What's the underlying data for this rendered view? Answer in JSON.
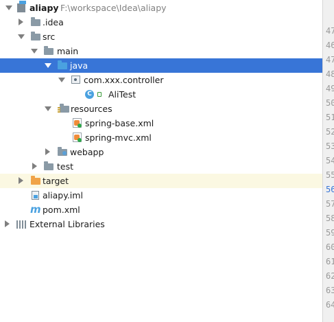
{
  "project_tree": {
    "root": {
      "name": "aliapy",
      "path": "F:\\workspace\\Idea\\aliapy",
      "icon": "module-folder-icon"
    },
    "idea": {
      "name": ".idea",
      "icon": "folder-icon"
    },
    "src": {
      "name": "src",
      "icon": "folder-icon"
    },
    "main": {
      "name": "main",
      "icon": "folder-icon"
    },
    "java": {
      "name": "java",
      "icon": "source-folder-icon",
      "selected": true
    },
    "package": {
      "name": "com.xxx.controller",
      "icon": "package-icon"
    },
    "class": {
      "name": "AliTest",
      "icon": "class-c-icon"
    },
    "resources": {
      "name": "resources",
      "icon": "resources-folder-icon"
    },
    "spring_base": {
      "name": "spring-base.xml",
      "icon": "spring-xml-icon"
    },
    "spring_mvc": {
      "name": "spring-mvc.xml",
      "icon": "spring-xml-icon"
    },
    "webapp": {
      "name": "webapp",
      "icon": "web-folder-icon"
    },
    "test": {
      "name": "test",
      "icon": "folder-icon"
    },
    "target": {
      "name": "target",
      "icon": "excluded-folder-icon",
      "highlighted": true
    },
    "iml": {
      "name": "aliapy.iml",
      "icon": "iml-file-icon"
    },
    "pom": {
      "name": "pom.xml",
      "icon": "maven-icon"
    },
    "libs": {
      "name": "External Libraries",
      "icon": "libraries-icon"
    }
  },
  "editor_gutter": {
    "lines": [
      "47",
      "46",
      "47",
      "48",
      "49",
      "50",
      "51",
      "52",
      "53",
      "54",
      "55",
      "56",
      "57",
      "58",
      "59",
      "60",
      "61",
      "62",
      "63",
      "64"
    ],
    "current_line": "56"
  },
  "colors": {
    "selection": "#3875d7",
    "highlight_row": "#fbf8e2",
    "folder": "#8a9aa6",
    "source_folder": "#4aa1e0",
    "excluded_folder": "#f0a348"
  }
}
